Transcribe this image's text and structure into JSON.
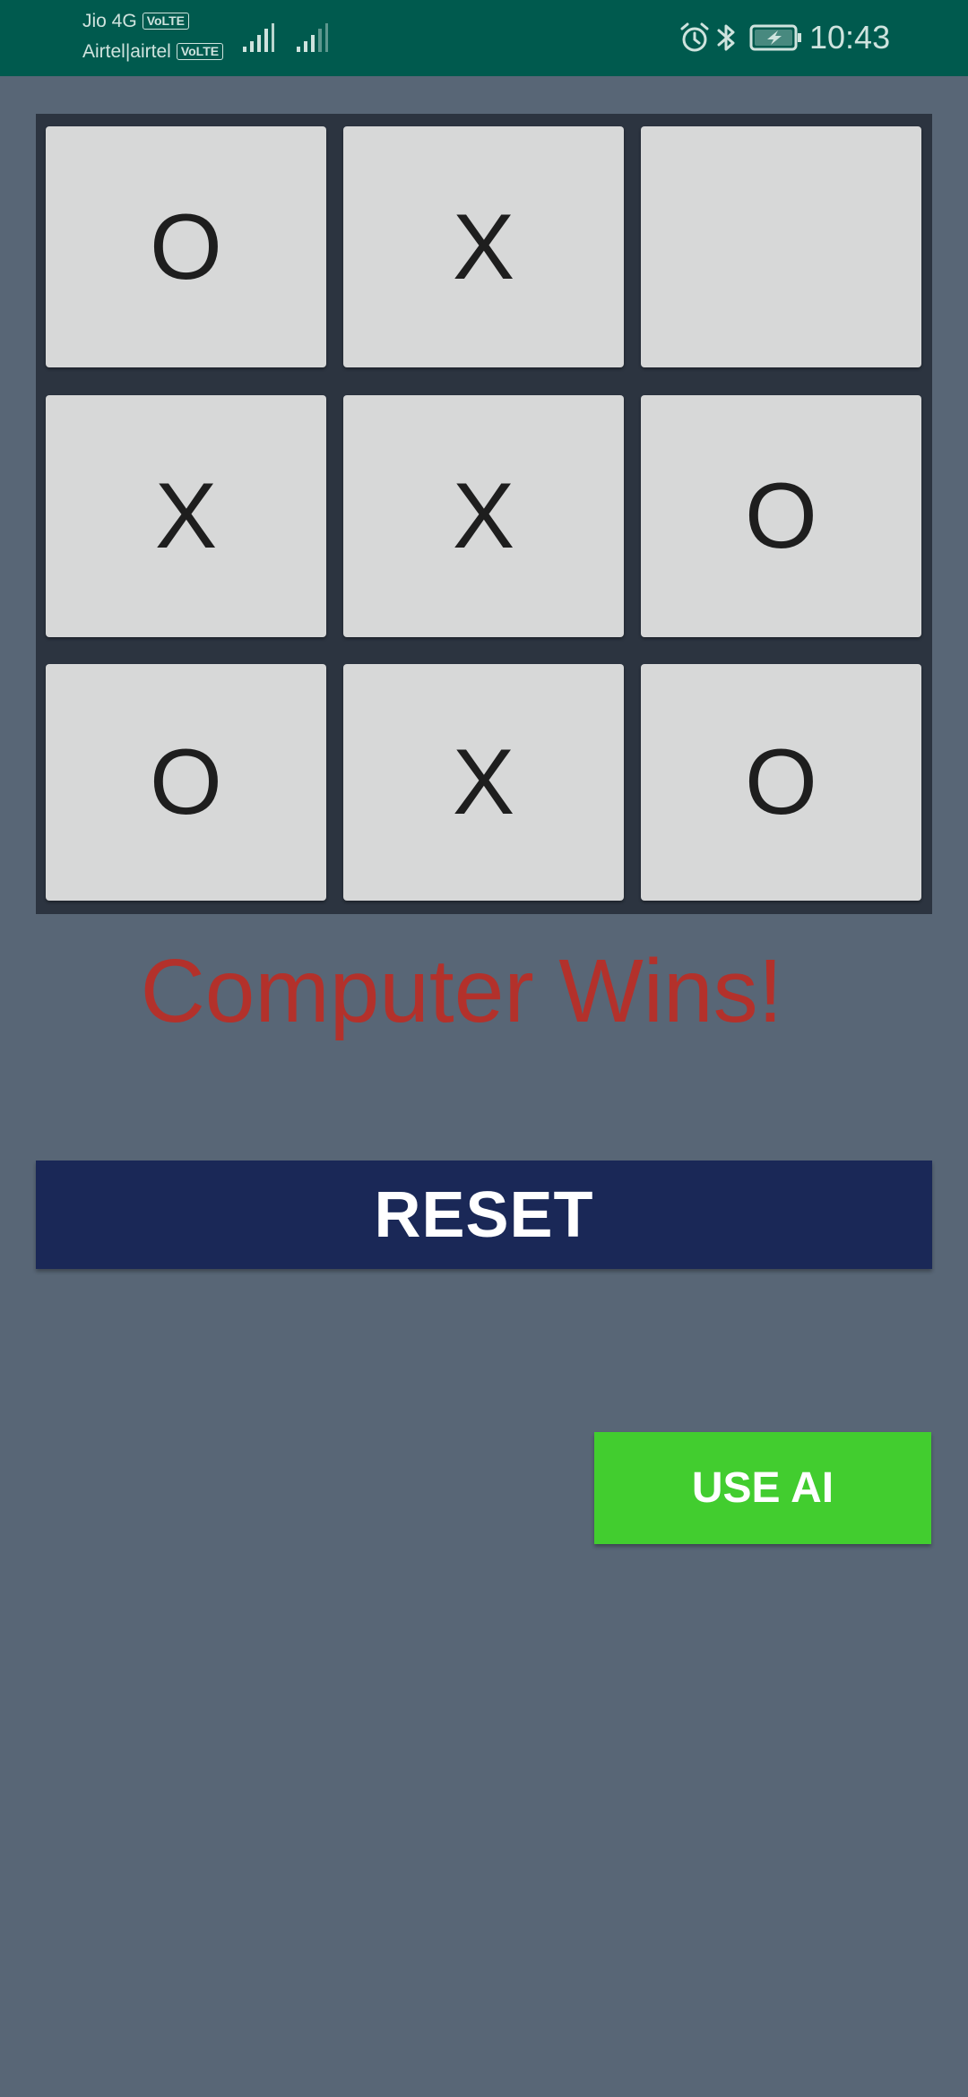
{
  "status_bar": {
    "carrier_1": "Jio 4G",
    "carrier_2": "Airtel|airtel",
    "volte_badge": "VoLTE",
    "time": "10:43",
    "icons": [
      "signal-icon",
      "signal-icon",
      "alarm-icon",
      "bluetooth-icon",
      "battery-charging-icon"
    ],
    "background_color": "#005A4E"
  },
  "board": {
    "cells": [
      [
        "O",
        "X",
        ""
      ],
      [
        "X",
        "X",
        "O"
      ],
      [
        "O",
        "X",
        "O"
      ]
    ]
  },
  "result": {
    "text": "Computer Wins!",
    "color": "#B3312B"
  },
  "buttons": {
    "reset_label": "RESET",
    "reset_color": "#1A2857",
    "use_ai_label": "USE AI",
    "use_ai_color": "#42CD2F"
  },
  "background_color": "#586676"
}
